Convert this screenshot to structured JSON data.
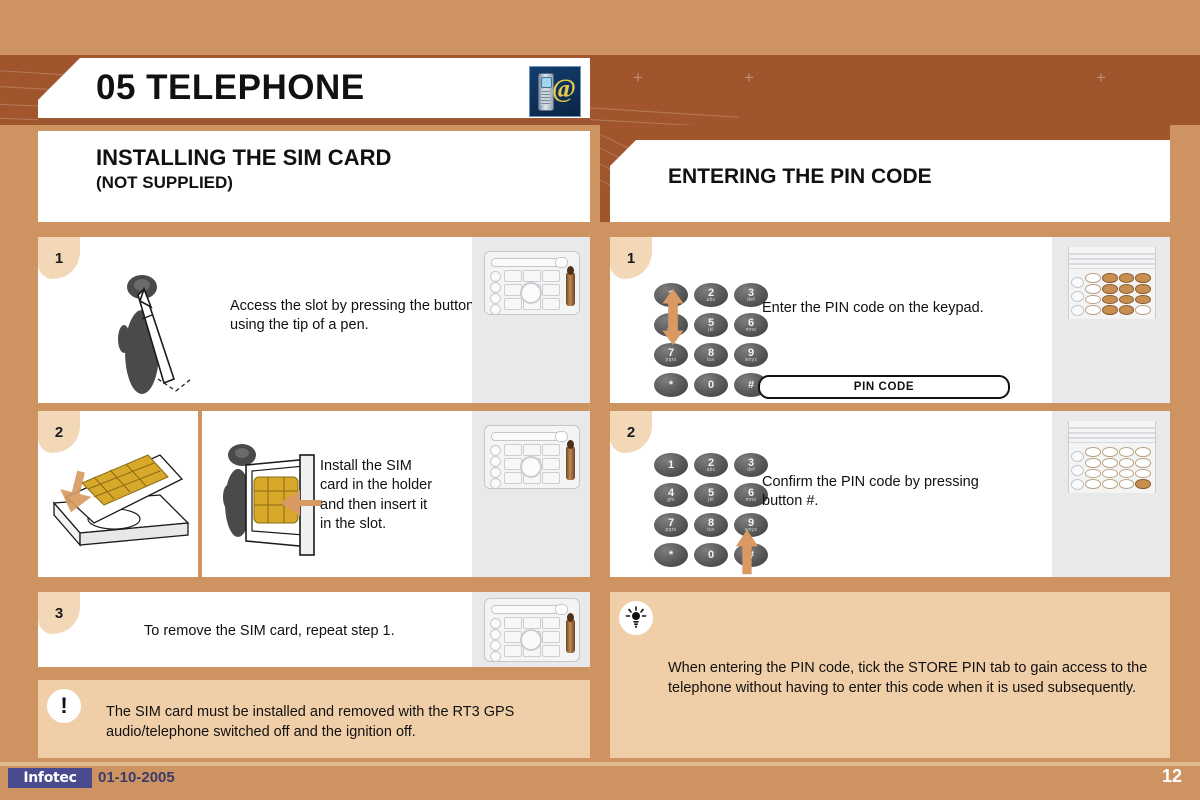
{
  "document": {
    "chapter_number": "05",
    "chapter_title": "05 TELEPHONE",
    "header_icon": "telephone-at-icon"
  },
  "sections": {
    "left": {
      "heading": "INSTALLING THE SIM CARD",
      "subheading": "(NOT SUPPLIED)"
    },
    "right": {
      "heading": "ENTERING THE PIN CODE"
    }
  },
  "left_steps": [
    {
      "number": "1",
      "text": "Access the slot by pressing the button using the tip of a pen.",
      "illustration": "pen-pressing-button",
      "thumbnail": "radio-head-unit"
    },
    {
      "number": "2",
      "text": "Install the SIM card in the holder and then insert it in the slot.",
      "illustration_a": "sim-card-in-tray",
      "illustration_b": "sim-card-holder-insert",
      "thumbnail": "radio-head-unit"
    },
    {
      "number": "3",
      "text": "To remove the SIM card, repeat step 1.",
      "thumbnail": "radio-head-unit"
    }
  ],
  "left_warning": {
    "icon": "exclamation-icon",
    "symbol": "!",
    "text": "The SIM card must be installed and removed with the RT3 GPS audio/telephone switched off and the ignition off."
  },
  "right_steps": [
    {
      "number": "1",
      "text": "Enter the PIN code on the keypad.",
      "button_label": "PIN CODE",
      "arrow": "up-down-arrow",
      "thumbnail": "phone-keypad"
    },
    {
      "number": "2",
      "text": "Confirm the PIN code by pressing button #.",
      "arrow": "up-arrow-to-hash",
      "thumbnail": "phone-keypad"
    }
  ],
  "right_tip": {
    "icon": "tip-light-icon",
    "text": "When entering the PIN code, tick the STORE PIN tab to gain access to the telephone without having to enter this code when it is used subsequently."
  },
  "keypad": {
    "keys": [
      {
        "digit": "1",
        "letters": ""
      },
      {
        "digit": "2",
        "letters": "abc"
      },
      {
        "digit": "3",
        "letters": "def"
      },
      {
        "digit": "4",
        "letters": "ghi"
      },
      {
        "digit": "5",
        "letters": "jkl"
      },
      {
        "digit": "6",
        "letters": "mno"
      },
      {
        "digit": "7",
        "letters": "pqrs"
      },
      {
        "digit": "8",
        "letters": "tuv"
      },
      {
        "digit": "9",
        "letters": "wxyz"
      },
      {
        "digit": "*",
        "letters": ""
      },
      {
        "digit": "0",
        "letters": ""
      },
      {
        "digit": "#",
        "letters": ""
      }
    ]
  },
  "footer": {
    "logo_text": "Infotec",
    "date": "01-10-2005",
    "page_number": "12"
  },
  "colors": {
    "background": "#cd9462",
    "banner_brown": "#a0552c",
    "panel_white": "#ffffff",
    "badge_beige": "#f3d8b8",
    "note_beige": "#f0cfa8",
    "thumb_grey": "#e9e9e9",
    "accent_orange": "#d89a62",
    "sim_gold": "#d8a82b",
    "logo_blue": "#4a4a8f"
  }
}
